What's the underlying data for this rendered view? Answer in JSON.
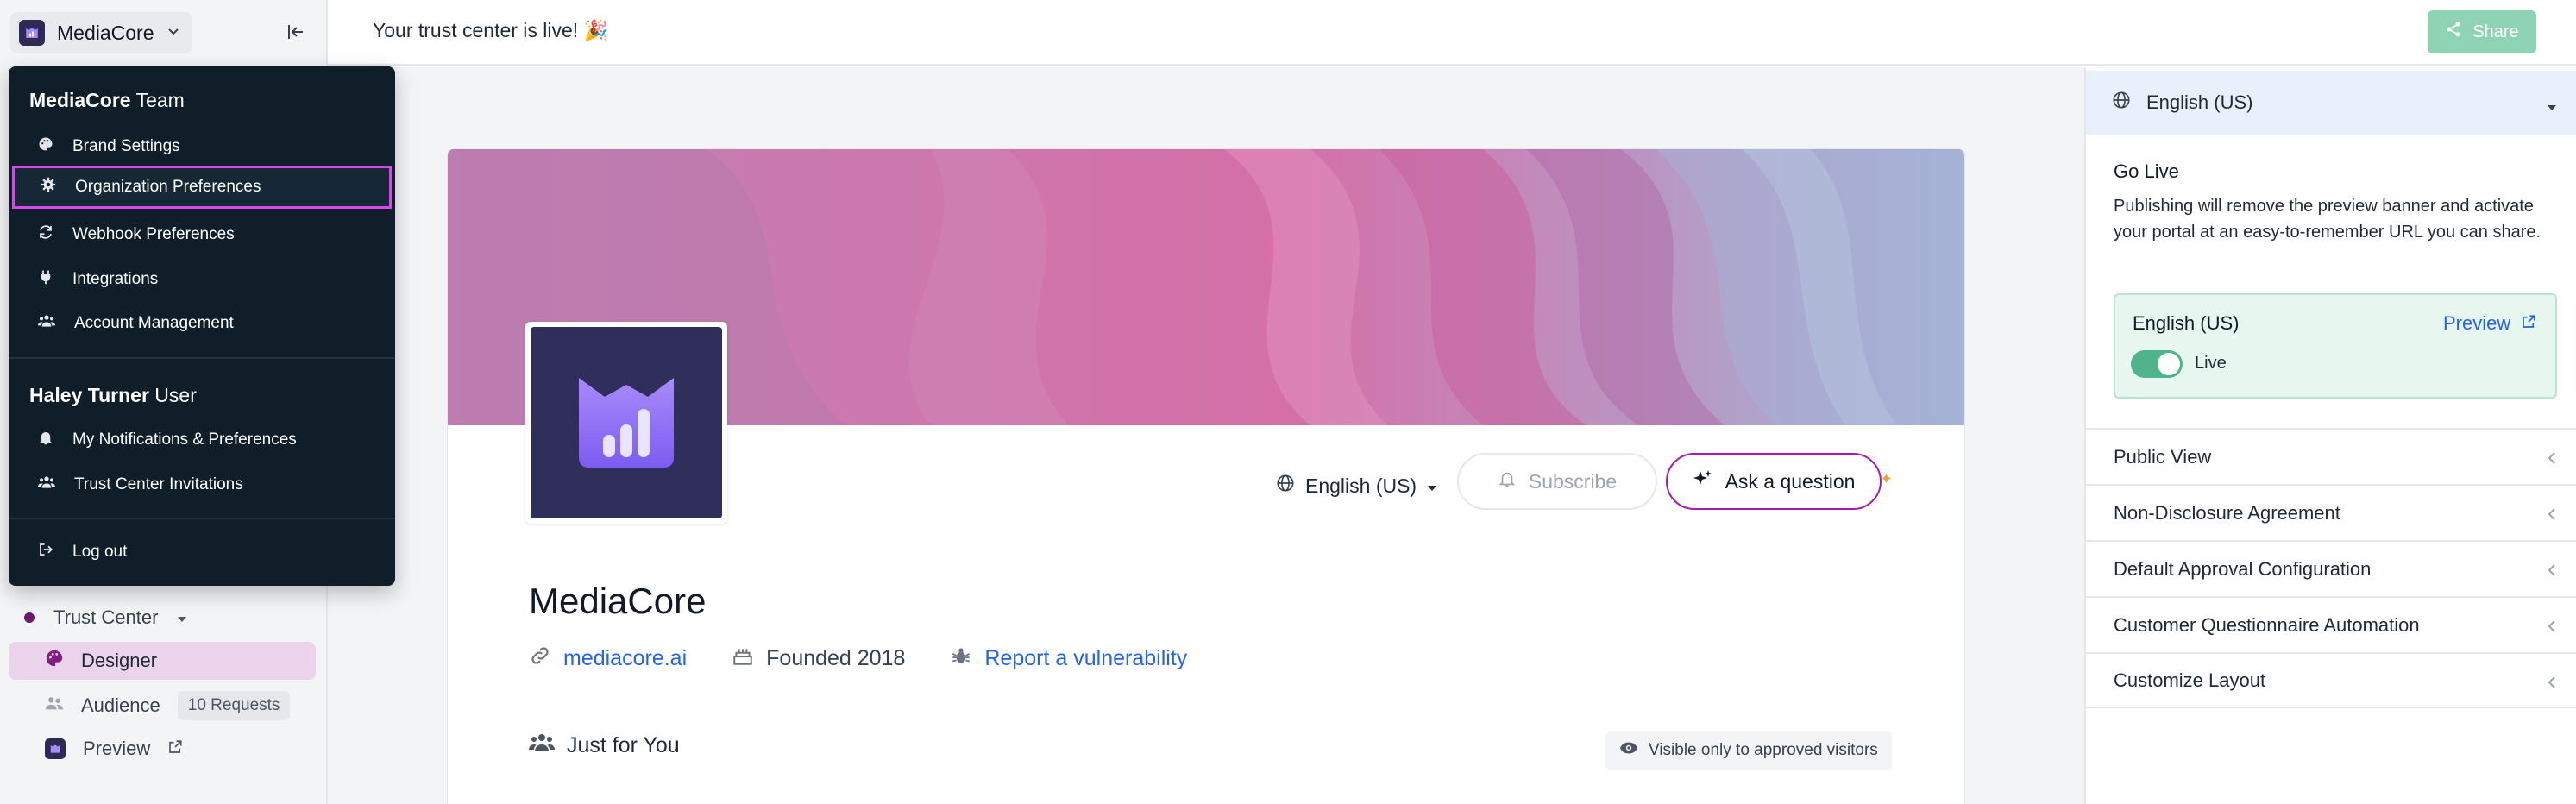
{
  "sidebar": {
    "org_name": "MediaCore",
    "trust_center_label": "Trust Center",
    "items": [
      {
        "label": "Designer"
      },
      {
        "label": "Audience",
        "badge": "10 Requests"
      },
      {
        "label": "Preview"
      }
    ]
  },
  "menu": {
    "team_name": "MediaCore",
    "team_suffix": "Team",
    "team_items": [
      {
        "label": "Brand Settings",
        "icon": "palette-icon"
      },
      {
        "label": "Organization Preferences",
        "icon": "gear-icon"
      },
      {
        "label": "Webhook Preferences",
        "icon": "refresh-icon"
      },
      {
        "label": "Integrations",
        "icon": "plug-icon"
      },
      {
        "label": "Account Management",
        "icon": "users-icon"
      }
    ],
    "user_name": "Haley Turner",
    "user_suffix": "User",
    "user_items": [
      {
        "label": "My Notifications & Preferences",
        "icon": "bell-icon"
      },
      {
        "label": "Trust Center Invitations",
        "icon": "users-icon"
      }
    ],
    "logout_label": "Log out"
  },
  "topbar": {
    "message": "Your trust center is live! 🎉",
    "share_label": "Share"
  },
  "portal": {
    "language": "English (US)",
    "subscribe_label": "Subscribe",
    "ask_label": "Ask a question",
    "company_name": "MediaCore",
    "website": "mediacore.ai",
    "founded": "Founded 2018",
    "report_label": "Report a vulnerability",
    "section_title": "Just for You",
    "visibility_note": "Visible only to approved visitors"
  },
  "panel": {
    "language": "English (US)",
    "go_live_title": "Go Live",
    "go_live_desc": "Publishing will remove the preview banner and activate your portal at an easy-to-remember URL you can share.",
    "live_lang": "English (US)",
    "preview_label": "Preview",
    "live_label": "Live",
    "live_on": true,
    "sections": [
      "Public View",
      "Non-Disclosure Agreement",
      "Default Approval Configuration",
      "Customer Questionnaire Automation",
      "Customize Layout"
    ]
  },
  "colors": {
    "brand": "#302f5c",
    "accent": "#a21caf",
    "menu_bg": "#0f1e29",
    "share": "#8dd3b4"
  }
}
